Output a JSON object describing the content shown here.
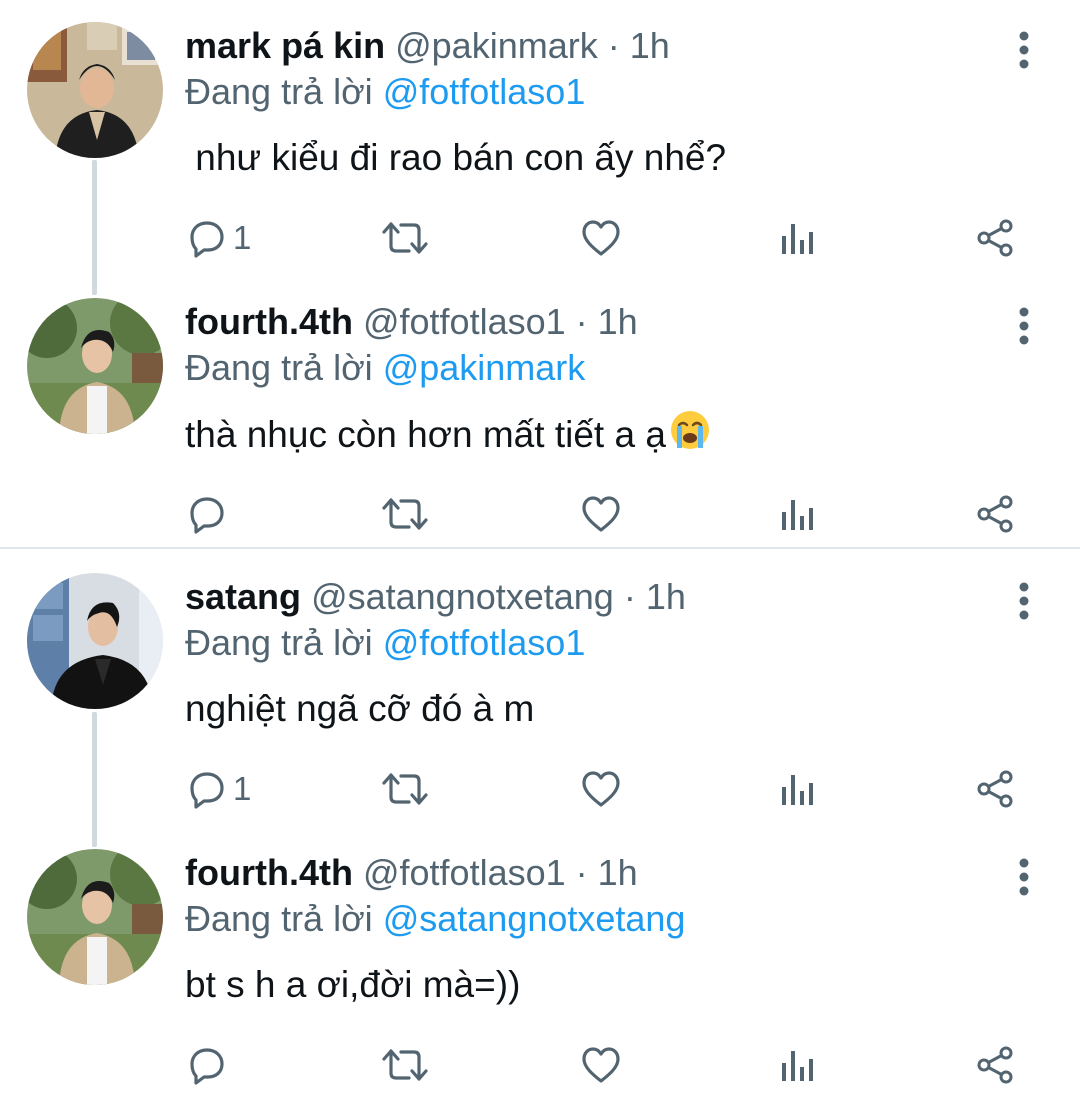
{
  "tweets": [
    {
      "display_name": "mark pá kin",
      "handle": "@pakinmark",
      "time_sep": " · ",
      "time": "1h",
      "reply_prefix": "Đang trả lời ",
      "reply_to": "@fotfotlaso1",
      "text": " như kiểu đi rao bán con ấy nhể?",
      "reply_count": "1",
      "icons": [
        "reply-icon",
        "retweet-icon",
        "like-icon",
        "analytics-icon",
        "share-icon",
        "more-icon"
      ]
    },
    {
      "display_name": "fourth.4th",
      "handle": "@fotfotlaso1",
      "time_sep": " · ",
      "time": "1h",
      "reply_prefix": "Đang trả lời ",
      "reply_to": "@pakinmark",
      "text": "thà nhục còn hơn mất tiết a ạ",
      "emoji": "loudly-crying-face-emoji",
      "reply_count": ""
    },
    {
      "display_name": "satang",
      "handle": "@satangnotxetang",
      "time_sep": " · ",
      "time": "1h",
      "reply_prefix": "Đang trả lời ",
      "reply_to": "@fotfotlaso1",
      "text": "nghiệt ngã cỡ đó à m",
      "reply_count": "1"
    },
    {
      "display_name": "fourth.4th",
      "handle": "@fotfotlaso1",
      "time_sep": " · ",
      "time": "1h",
      "reply_prefix": "Đang trả lời ",
      "reply_to": "@satangnotxetang",
      "text": "bt s h a ơi,đời mà=))",
      "reply_count": ""
    }
  ],
  "colors": {
    "text_primary": "#0f1419",
    "text_secondary": "#536471",
    "mention": "#1d9bf0",
    "icon": "#536471",
    "thread_line": "#cfd9de"
  }
}
